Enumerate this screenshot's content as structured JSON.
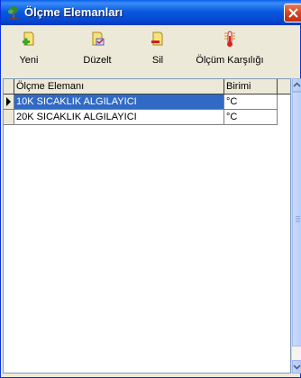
{
  "window": {
    "title": "Ölçme Elemanları"
  },
  "toolbar": {
    "new_label": "Yeni",
    "edit_label": "Düzelt",
    "delete_label": "Sil",
    "mapping_label": "Ölçüm Karşılığı"
  },
  "table": {
    "columns": [
      "Ölçme Elemanı",
      "Birimi"
    ],
    "rows": [
      {
        "name": "10K SICAKLIK ALGILAYICI",
        "unit": "°C",
        "selected": true
      },
      {
        "name": "20K SICAKLIK ALGILAYICI",
        "unit": "°C",
        "selected": false
      }
    ]
  },
  "colors": {
    "titlebar": "#0A5AE0",
    "selection": "#316AC5",
    "window_bg": "#ECE9D8",
    "close": "#D3411E"
  }
}
